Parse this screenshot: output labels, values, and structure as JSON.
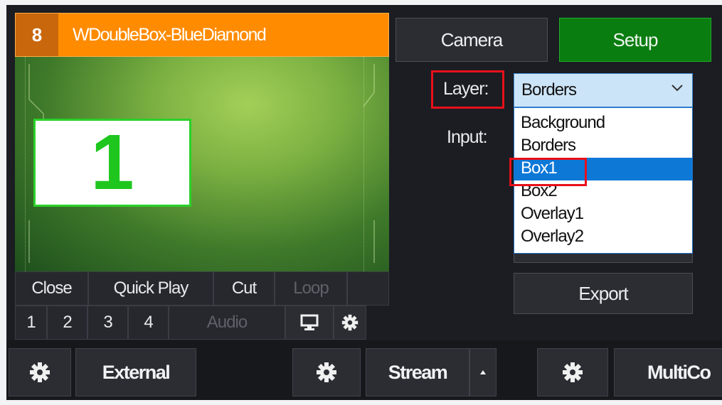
{
  "input": {
    "number": "8",
    "title": "WDoubleBox-BlueDiamond",
    "preview_box_text": "1",
    "controls_row1": [
      "Close",
      "Quick Play",
      "Cut",
      "Loop"
    ],
    "controls_row2": [
      "1",
      "2",
      "3",
      "4",
      "Audio"
    ]
  },
  "buttons": {
    "camera": "Camera",
    "setup": "Setup",
    "export": "Export"
  },
  "layer": {
    "label": "Layer:",
    "selected": "Borders",
    "options": [
      "Background",
      "Borders",
      "Box1",
      "Box2",
      "Overlay1",
      "Overlay2"
    ],
    "highlighted_index": 2
  },
  "input_field": {
    "label": "Input:"
  },
  "bottom_bar": {
    "external": "External",
    "stream": "Stream",
    "multicorder": "MultiCo"
  },
  "colors": {
    "header": "#ff8b00",
    "setup_green": "#0a7d10",
    "highlight_red": "#e8101b",
    "dropdown_selection": "#0e78d7"
  }
}
